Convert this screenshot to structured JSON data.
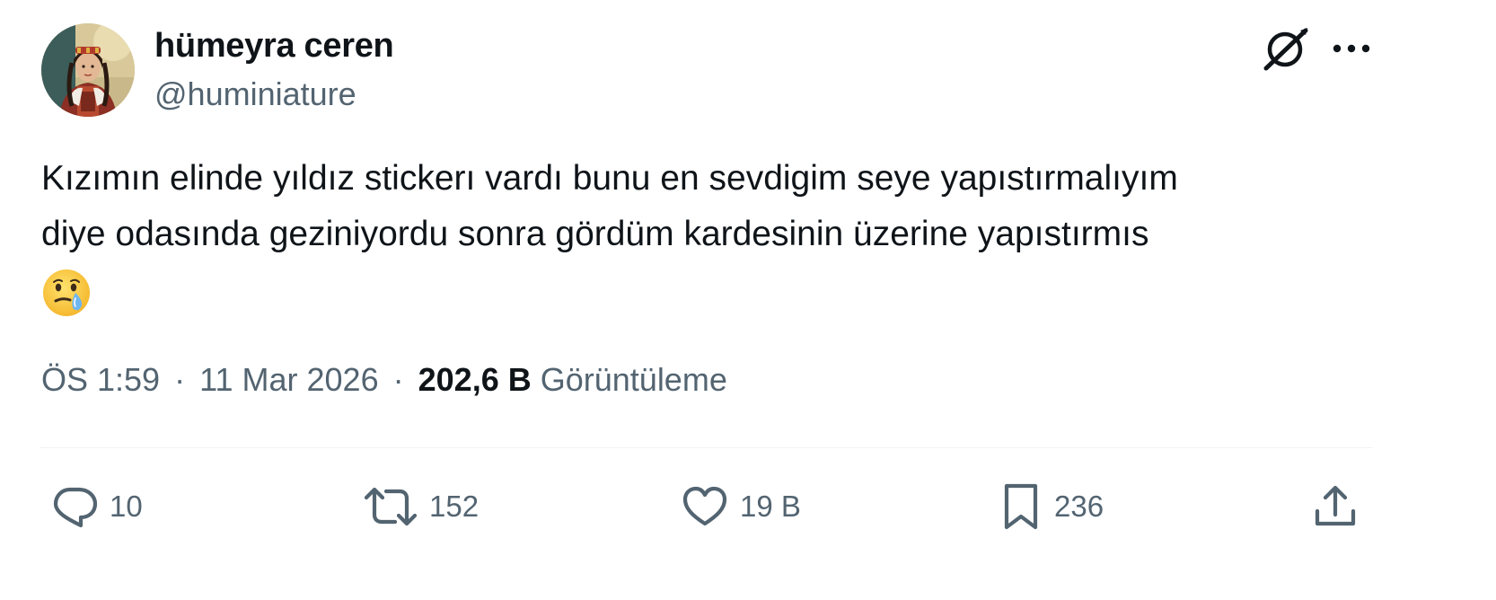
{
  "user": {
    "display_name": "hümeyra ceren",
    "handle": "@huminiature"
  },
  "tweet": {
    "text_lines": [
      "Kızımın elinde yıldız stickerı vardı bunu en sevdigim seye yapıstırmalıyım",
      "diye odasında geziniyordu sonra gördüm kardesinin üzerine yapıstırmıs"
    ],
    "emoji": "face-holding-back-tears"
  },
  "meta": {
    "time": "ÖS 1:59",
    "separator": "·",
    "date": "11 Mar 2026",
    "views_count": "202,6 B",
    "views_label": "Görüntüleme"
  },
  "actions": {
    "replies": "10",
    "reposts": "152",
    "likes": "19 B",
    "bookmarks": "236"
  },
  "icons": {
    "top_right": [
      "grok-icon",
      "more-icon"
    ],
    "actions": [
      "reply-icon",
      "repost-icon",
      "like-icon",
      "bookmark-icon",
      "share-icon"
    ]
  },
  "colors": {
    "text_primary": "#0f1419",
    "text_secondary": "#536471",
    "divider": "#eff3f4",
    "background": "#ffffff"
  }
}
